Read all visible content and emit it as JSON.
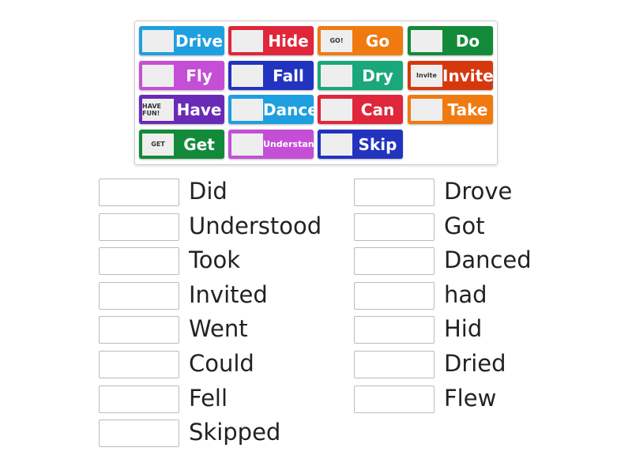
{
  "tiles": [
    {
      "label": "Drive",
      "color": "#1e9fe0",
      "icon": "car-driving-image"
    },
    {
      "label": "Hide",
      "color": "#e0263a",
      "icon": "hiding-person-image"
    },
    {
      "label": "Go",
      "color": "#f07a10",
      "icon": "go-button-image",
      "img_text": "GO!"
    },
    {
      "label": "Do",
      "color": "#128a3a",
      "icon": "sticky-note-image"
    },
    {
      "label": "Fly",
      "color": "#c44fd6",
      "icon": "airplane-sky-image"
    },
    {
      "label": "Fall",
      "color": "#2233c0",
      "icon": "falling-person-image"
    },
    {
      "label": "Dry",
      "color": "#1aa87a",
      "icon": "drying-face-image"
    },
    {
      "label": "Invite",
      "color": "#d6380e",
      "icon": "invite-script-image",
      "img_text": "Invite"
    },
    {
      "label": "Have",
      "color": "#6a2ab8",
      "icon": "have-fun-image",
      "img_text": "HAVE FUN!"
    },
    {
      "label": "Dance",
      "color": "#1e9fe0",
      "icon": "dancer-image"
    },
    {
      "label": "Can",
      "color": "#e0263a",
      "icon": "we-can-do-it-poster-image"
    },
    {
      "label": "Take",
      "color": "#f07a10",
      "icon": "hand-print-image"
    },
    {
      "label": "Get",
      "color": "#128a3a",
      "icon": "get-button-image",
      "img_text": "GET"
    },
    {
      "label": "Understand",
      "color": "#c44fd6",
      "icon": "confused-person-image"
    },
    {
      "label": "Skip",
      "color": "#2233c0",
      "icon": "jump-rope-image"
    }
  ],
  "left_words": [
    "Did",
    "Understood",
    "Took",
    "Invited",
    "Went",
    "Could",
    "Fell",
    "Skipped"
  ],
  "right_words": [
    "Drove",
    "Got",
    "Danced",
    "had",
    "Hid",
    "Dried",
    "Flew"
  ]
}
